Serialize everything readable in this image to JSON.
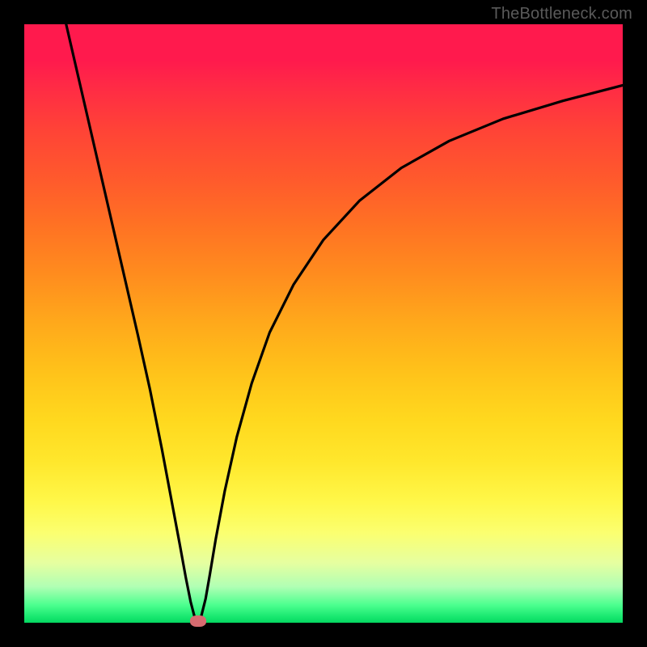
{
  "watermark": "TheBottleneck.com",
  "chart_data": {
    "type": "line",
    "title": "",
    "xlabel": "",
    "ylabel": "",
    "xlim": [
      0,
      100
    ],
    "ylim": [
      0,
      100
    ],
    "grid": false,
    "legend": false,
    "background": "red-yellow-green vertical gradient",
    "series": [
      {
        "name": "curve",
        "x": [
          7,
          10,
          13,
          16,
          19,
          21,
          23,
          24.5,
          26,
          27,
          27.8,
          28.4,
          29,
          29.6,
          30.3,
          31,
          32,
          33.5,
          35.5,
          38,
          41,
          45,
          50,
          56,
          63,
          71,
          80,
          90,
          100
        ],
        "values": [
          100,
          87,
          74,
          61,
          48,
          39,
          29,
          21,
          13,
          7.5,
          3.5,
          1.2,
          0.3,
          1.2,
          4,
          8,
          14,
          22,
          31,
          40,
          48.5,
          56.5,
          64,
          70.5,
          76,
          80.5,
          84.2,
          87.2,
          89.8
        ]
      }
    ],
    "marker": {
      "x": 29,
      "y": 0.3
    },
    "colors": {
      "gradient_top": "#ff1a4d",
      "gradient_mid": "#ffc21a",
      "gradient_bottom": "#05d760",
      "curve": "#000000",
      "marker": "#d66b70",
      "frame": "#000000"
    }
  }
}
